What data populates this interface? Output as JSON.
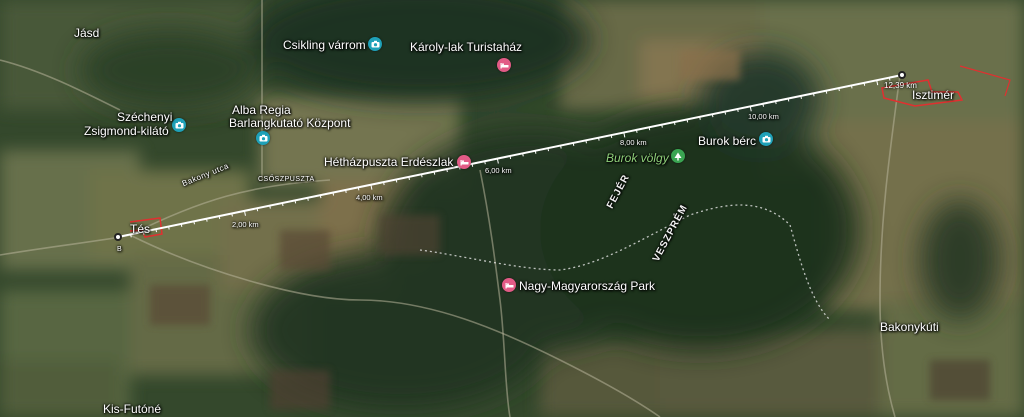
{
  "map": {
    "places": {
      "jasd": "Jásd",
      "tes": "Tés",
      "tes_sub": "B",
      "isztimer": "Isztimér",
      "bakonykuti": "Bakonykúti",
      "kis_futone": "Kis-Futóné",
      "csoszpuszta": "CSŐSZPUSZTA",
      "bakony_street": "Bakony utca"
    },
    "pois": {
      "csikling": "Csikling várrom",
      "karoly_lak": "Károly-lak Turistaház",
      "szechenyi_line1": "Széchenyi",
      "szechenyi_line2": "Zsigmond-kilátó",
      "alba_line1": "Alba Regia",
      "alba_line2": "Barlangkutató Központ",
      "hethaz": "Hétházpuszta Erdészlak",
      "burok_berc": "Burok bérc",
      "burok_volgy": "Burok völgy",
      "nagy_magyar": "Nagy-Magyarország Park"
    },
    "regions": {
      "fejer": "FEJÉR",
      "veszprem": "VESZPRÉM"
    },
    "measurement": {
      "total": "12,39 km",
      "ticks": [
        "2,00 km",
        "4,00 km",
        "6,00 km",
        "8,00 km",
        "10,00 km"
      ]
    },
    "colors": {
      "photo_pin": "#1fa1b8",
      "lodging_pin": "#e25b86",
      "park_pin": "#3aa552",
      "measure_line": "#ffffff",
      "admin_border": "#e03030"
    },
    "icons": {
      "photo": "camera-icon",
      "lodging": "bed-icon",
      "park": "tree-icon"
    }
  }
}
